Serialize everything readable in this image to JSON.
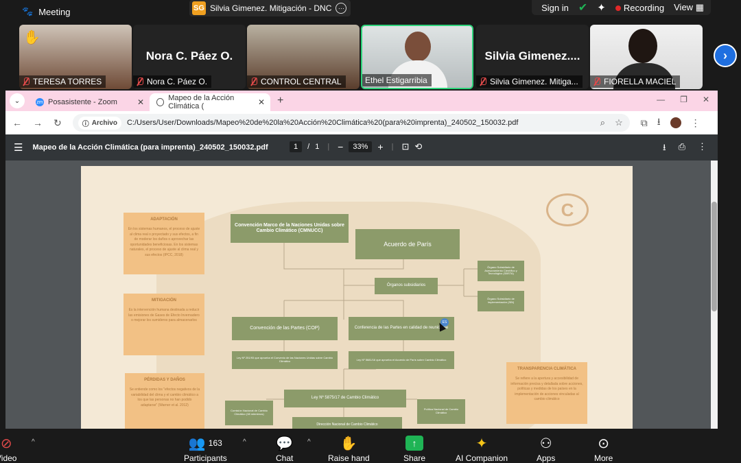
{
  "zoom_top": {
    "meeting_label": "Meeting",
    "share_initials": "SG",
    "share_title": "Silvia Gimenez.  Mitigación - DNC",
    "sign_in": "Sign in",
    "recording": "Recording",
    "view": "View"
  },
  "participants_strip": [
    {
      "name": "TERESA TORRES",
      "muted": true,
      "hand_raised": true
    },
    {
      "name": "Nora C. Páez O.",
      "big_name": "Nora C. Páez O.",
      "muted": true
    },
    {
      "name": "CONTROL CENTRAL",
      "muted": true
    },
    {
      "name": "Ethel Estigarribia",
      "muted": false,
      "active_speaker": true
    },
    {
      "name": "Silvia Gimenez.  Mitiga...",
      "big_name": "Silvia  Gimenez....",
      "muted": true
    },
    {
      "name": "FIORELLA MACIEL",
      "muted": true
    }
  ],
  "browser": {
    "tabs": [
      {
        "title": "Posasistente - Zoom",
        "active": false
      },
      {
        "title": "Mapeo de la Acción Climática (",
        "active": true
      }
    ],
    "archivo_chip": "Archivo",
    "url": "C:/Users/User/Downloads/Mapeo%20de%20la%20Acción%20Climática%20(para%20imprenta)_240502_150032.pdf"
  },
  "pdf": {
    "title": "Mapeo de la Acción Climática (para imprenta)_240502_150032.pdf",
    "page_current": "1",
    "page_sep": "/",
    "page_total": "1",
    "zoom": "33%",
    "diagram": {
      "cmnucc": "Convención Marco de la Naciones Unidas sobre Cambio Climático (CMNUCC)",
      "paris": "Acuerdo de París",
      "organos": "Órganos subsidiarios",
      "sbsta": "Órgano Subsidiario de Asesoramiento Científico y Tecnológico (SBSTA)",
      "sbi": "Órgano Subsidiario de Implementación (SBI)",
      "cop": "Convención de las Partes (COP)",
      "cma": "Conferencia de las Partes en calidad de reunión de",
      "ley1": "Ley Nº 251/93 que aprueba el Convenio de las Naciones Unidas sobre Cambio Climático",
      "ley2": "Ley Nº 5681/16 que aprueba el Acuerdo de París sobre Cambio Climático",
      "ley3": "Ley Nº 5875/17 de Cambio Climático",
      "comision": "Comisión Nacional de Cambio Climático (38 miembros)",
      "politica": "Política Nacional de Cambio Climático",
      "direccion": "Dirección Nacional de Cambio Climático",
      "adaptacion_h": "ADAPTACIÓN",
      "adaptacion_t": "En los sistemas humanos, el proceso de ajuste al clima real o proyectado y sus efectos, a fin de moderar los daños o aprovechar las oportunidades beneficiosas. En los sistemas naturales, el proceso de ajuste al clima real y sus efectos (IPCC, 2018)",
      "mitigacion_h": "MITIGACIÓN",
      "mitigacion_t": "Es la intervención humana destinada a reducir las emisiones de Gases de Efecto Invernadero o mejorar los sumideros para almacenarlos",
      "perdidas_h": "PÉRDIDAS Y DAÑOS",
      "perdidas_t": "Se entiende como los \"efectos negativos de la variabilidad del clima y el cambio climático a los que las personas no han podido adaptarse\" (Warner et al. 2012)",
      "transparencia_h": "TRANSPARENCIA CLIMÁTICA",
      "transparencia_t": "Se refiere a la apertura y accesibilidad de información precisa y detallada sobre acciones, políticas y medidas de los países en la implementación de acciones vinculadas al cambio climático"
    },
    "cursor_badge": "ES"
  },
  "zoom_bottom": {
    "video": "Video",
    "participants": "Participants",
    "participants_count": "163",
    "chat": "Chat",
    "raise_hand": "Raise hand",
    "share": "Share",
    "ai_companion": "AI Companion",
    "apps": "Apps",
    "more": "More"
  },
  "colors": {
    "node_green": "#8c9b6a",
    "node_orange": "#f2c185",
    "page_bg": "#f4e9d6",
    "tab_bar_pink": "#fbd5e6",
    "recording_red": "#e02828",
    "share_green": "#1fb455"
  }
}
